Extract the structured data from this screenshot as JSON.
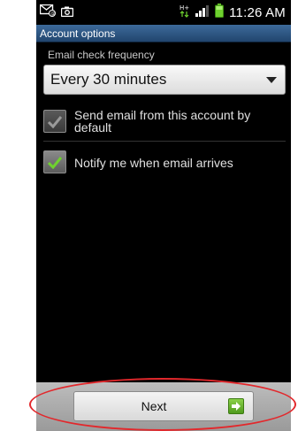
{
  "status_bar": {
    "time": "11:26 AM",
    "icons": [
      "email-notification-icon",
      "camera-icon",
      "hspa-data-icon",
      "signal-strength-icon",
      "battery-icon"
    ]
  },
  "title_bar": {
    "title": "Account options"
  },
  "email_check": {
    "label": "Email check frequency",
    "selected": "Every 30 minutes"
  },
  "options": [
    {
      "label_line1": "Send email from this account by",
      "label_line2": "default",
      "checked": true,
      "enabled": false
    },
    {
      "label_line1": "Notify me when email arrives",
      "checked": true,
      "enabled": true
    }
  ],
  "bottom": {
    "next_label": "Next"
  },
  "colors": {
    "title_bar": "#2f5683",
    "check_green": "#6fd12f",
    "check_disabled": "#9a9a9a",
    "annotation": "#e2282c"
  }
}
